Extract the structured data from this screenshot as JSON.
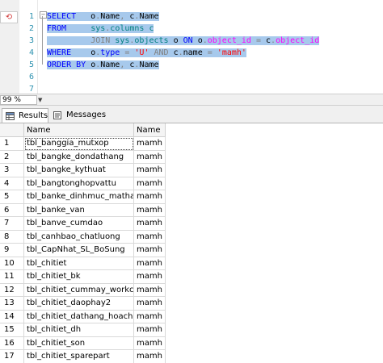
{
  "editor": {
    "line_numbers": [
      "1",
      "2",
      "3",
      "4",
      "5",
      "6",
      "7"
    ],
    "lines": [
      [
        {
          "t": "SELECT",
          "c": "kw"
        },
        {
          "t": "   o",
          "c": "pl"
        },
        {
          "t": ".",
          "c": "gr"
        },
        {
          "t": "Name",
          "c": "pl"
        },
        {
          "t": ", ",
          "c": "gr"
        },
        {
          "t": "c",
          "c": "pl"
        },
        {
          "t": ".",
          "c": "gr"
        },
        {
          "t": "Name",
          "c": "pl"
        }
      ],
      [
        {
          "t": "FROM",
          "c": "kw"
        },
        {
          "t": "     sys",
          "c": "ob"
        },
        {
          "t": ".",
          "c": "gr"
        },
        {
          "t": "columns c",
          "c": "ob"
        }
      ],
      [
        {
          "t": "         ",
          "c": "pl"
        },
        {
          "t": "JOIN",
          "c": "gr"
        },
        {
          "t": " sys",
          "c": "ob"
        },
        {
          "t": ".",
          "c": "gr"
        },
        {
          "t": "objects",
          "c": "ob"
        },
        {
          "t": " o ",
          "c": "pl"
        },
        {
          "t": "ON",
          "c": "kw"
        },
        {
          "t": " o",
          "c": "pl"
        },
        {
          "t": ".",
          "c": "gr"
        },
        {
          "t": "object_id",
          "c": "fn"
        },
        {
          "t": " = ",
          "c": "gr"
        },
        {
          "t": "c",
          "c": "pl"
        },
        {
          "t": ".",
          "c": "gr"
        },
        {
          "t": "object_id",
          "c": "fn"
        }
      ],
      [
        {
          "t": "WHERE",
          "c": "kw"
        },
        {
          "t": "    o",
          "c": "pl"
        },
        {
          "t": ".",
          "c": "gr"
        },
        {
          "t": "type",
          "c": "kw"
        },
        {
          "t": " = ",
          "c": "gr"
        },
        {
          "t": "'U'",
          "c": "st"
        },
        {
          "t": " AND ",
          "c": "gr"
        },
        {
          "t": "c",
          "c": "pl"
        },
        {
          "t": ".",
          "c": "gr"
        },
        {
          "t": "name",
          "c": "pl"
        },
        {
          "t": " = ",
          "c": "gr"
        },
        {
          "t": "'mamh'",
          "c": "st"
        }
      ],
      [
        {
          "t": "ORDER BY",
          "c": "kw"
        },
        {
          "t": " o",
          "c": "pl"
        },
        {
          "t": ".",
          "c": "gr"
        },
        {
          "t": "Name",
          "c": "pl"
        },
        {
          "t": ", ",
          "c": "gr"
        },
        {
          "t": "c",
          "c": "pl"
        },
        {
          "t": ".",
          "c": "gr"
        },
        {
          "t": "Name",
          "c": "pl"
        }
      ],
      [],
      []
    ]
  },
  "zoom": {
    "value": "99 %"
  },
  "tabs": {
    "results_label": "Results",
    "messages_label": "Messages"
  },
  "grid": {
    "headers": [
      "Name",
      "Name"
    ],
    "rows": [
      [
        "1",
        "tbl_banggia_mutxop",
        "mamh"
      ],
      [
        "2",
        "tbl_bangke_dondathang",
        "mamh"
      ],
      [
        "3",
        "tbl_bangke_kythuat",
        "mamh"
      ],
      [
        "4",
        "tbl_bangtonghopvattu",
        "mamh"
      ],
      [
        "5",
        "tbl_banke_dinhmuc_mathang",
        "mamh"
      ],
      [
        "6",
        "tbl_banke_van",
        "mamh"
      ],
      [
        "7",
        "tbl_banve_cumdao",
        "mamh"
      ],
      [
        "8",
        "tbl_canhbao_chatluong",
        "mamh"
      ],
      [
        "9",
        "tbl_CapNhat_SL_BoSung",
        "mamh"
      ],
      [
        "10",
        "tbl_chitiet",
        "mamh"
      ],
      [
        "11",
        "tbl_chitiet_bk",
        "mamh"
      ],
      [
        "12",
        "tbl_chitiet_cummay_workce...",
        "mamh"
      ],
      [
        "13",
        "tbl_chitiet_daophay2",
        "mamh"
      ],
      [
        "14",
        "tbl_chitiet_dathang_hoachat",
        "mamh"
      ],
      [
        "15",
        "tbl_chitiet_dh",
        "mamh"
      ],
      [
        "16",
        "tbl_chitiet_son",
        "mamh"
      ],
      [
        "17",
        "tbl_chitiet_sparepart",
        "mamh"
      ]
    ]
  }
}
